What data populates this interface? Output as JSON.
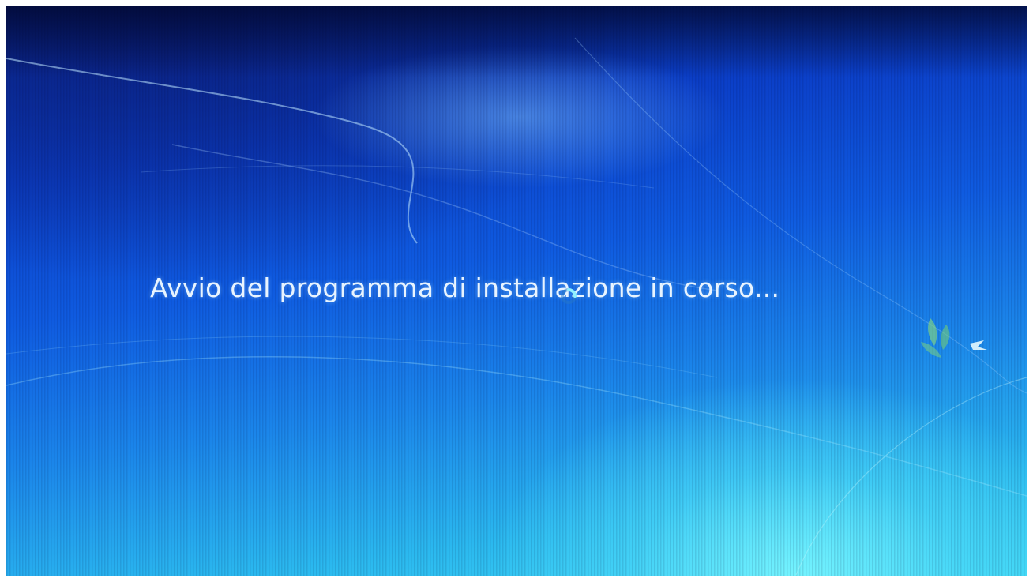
{
  "screen": {
    "status_text": "Avvio del programma di installazione in corso..."
  },
  "colors": {
    "background_dark": "#0a2a9a",
    "background_mid": "#0f5be0",
    "background_light": "#3fd6f4",
    "text": "#e8f4ff"
  },
  "icons": {
    "spinner": "loading-spinner-icon",
    "logo": "windows-logo-decor-icon"
  }
}
